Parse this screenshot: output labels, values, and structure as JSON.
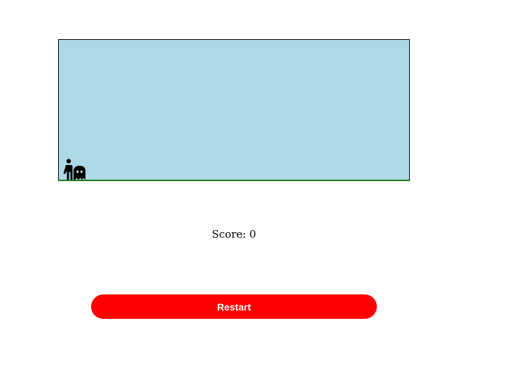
{
  "game": {
    "sky_color": "#add8e6",
    "ground_color": "#1a7a1a",
    "sprites": {
      "player_icon": "person-icon",
      "enemy_icon": "ghost-icon"
    }
  },
  "score": {
    "label": "Score:",
    "value": "0"
  },
  "controls": {
    "restart_label": "Restart",
    "restart_color": "#ff0000"
  }
}
